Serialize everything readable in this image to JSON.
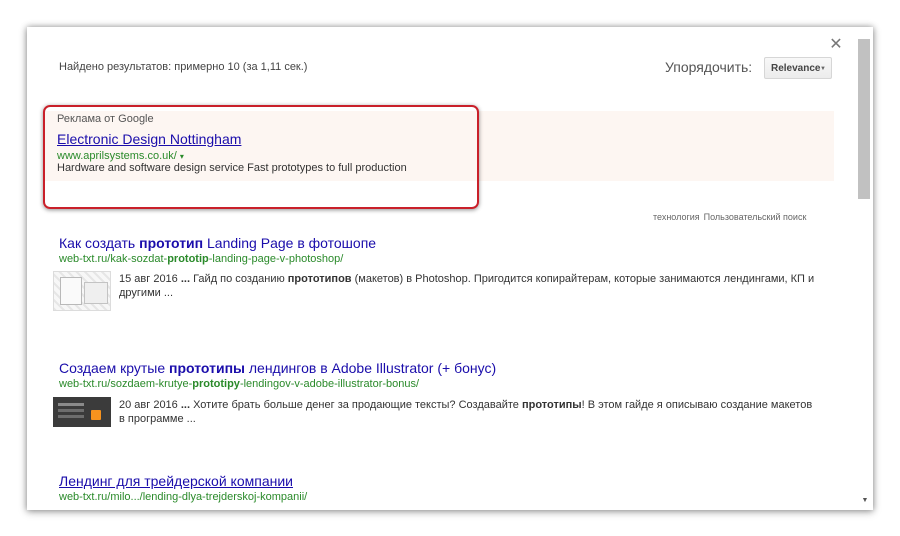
{
  "header": {
    "result_count": "Найдено результатов: примерно 10 (за 1,11 сек.)",
    "sort_label": "Упорядочить:",
    "sort_value": "Relevance",
    "close_glyph": "✕"
  },
  "ad": {
    "label": "Реклама от Google",
    "title": "Electronic Design Nottingham",
    "url": "www.aprilsystems.co.uk/",
    "url_arrow": "▾",
    "description": "Hardware and software design service Fast prototypes to full production"
  },
  "search_meta": {
    "tag": "технология",
    "engine": "Пользовательский поиск"
  },
  "results": [
    {
      "title_pre": "Как создать ",
      "title_bold": "прототип",
      "title_post": " Landing Page в фотошопе",
      "url_pre": "web-txt.ru/kak-sozdat-",
      "url_bold": "prototip",
      "url_post": "-landing-page-v-photoshop/",
      "snippet_date": "15 авг 2016 ",
      "snippet_ellipsis": "...",
      "snippet_a": " Гайд по созданию ",
      "snippet_bold": "прототипов",
      "snippet_b": " (макетов) в Photoshop. Пригодится копирайтерам, которые занимаются лендингами, КП и другими ..."
    },
    {
      "title_pre": "Создаем крутые ",
      "title_bold": "прототипы",
      "title_post": " лендингов в Adobe Illustrator (+ бонус)",
      "url_pre": "web-txt.ru/sozdaem-krutye-",
      "url_bold": "prototipy",
      "url_post": "-lendingov-v-adobe-illustrator-bonus/",
      "snippet_date": "20 авг 2016 ",
      "snippet_ellipsis": "...",
      "snippet_a": " Хотите брать больше денег за продающие тексты? Создавайте ",
      "snippet_bold": "прототипы",
      "snippet_b": "! В этом гайде я описываю создание макетов в программе ..."
    },
    {
      "title": "Лендинг для трейдерской компании",
      "url": "web-txt.ru/milo.../lending-dlya-trejderskoj-kompanii/"
    }
  ],
  "icons": {
    "close": "close-icon",
    "dropdown": "chevron-down-icon",
    "scroll_down": "arrow-down-icon"
  },
  "colors": {
    "link": "#1a0dab",
    "url_green": "#2a8a2a",
    "ad_bg": "#fdf6f2",
    "highlight_red": "#c9202a"
  }
}
